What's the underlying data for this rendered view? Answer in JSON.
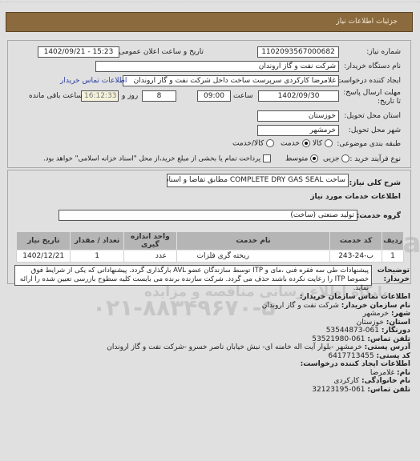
{
  "header": {
    "title": "جزئیات اطلاعات نیاز"
  },
  "form": {
    "need_number": {
      "label": "شماره نیاز:",
      "value": "1102093567000682"
    },
    "announce_datetime": {
      "label": "تاریخ و ساعت اعلان عمومی:",
      "value": "1402/09/21 - 15:23"
    },
    "buyer_org": {
      "label": "نام دستگاه خریدار:",
      "value": "شرکت نفت و گاز اروندان"
    },
    "requester": {
      "label": "ایجاد کننده درخواست:",
      "value": "غلامرضا کارکردی سرپرست ساخت داخل شرکت نفت و گاز اروندان"
    },
    "buyer_contact_link": "اطلاعات تماس خریدار",
    "deadline": {
      "label": "مهلت ارسال پاسخ: تا تاریخ:",
      "date": "1402/09/30",
      "time_label": "ساعت",
      "time": "09:00",
      "days": "8",
      "days_label": "روز و",
      "remaining": "16:12:33",
      "remaining_label": "ساعت باقی مانده"
    },
    "province": {
      "label": "استان محل تحویل:",
      "value": "خوزستان"
    },
    "city": {
      "label": "شهر محل تحویل:",
      "value": "خرمشهر"
    },
    "category": {
      "label": "طبقه بندی موضوعی:",
      "options": [
        {
          "label": "کالا",
          "selected": false
        },
        {
          "label": "خدمت",
          "selected": true
        },
        {
          "label": "کالا/خدمت",
          "selected": false
        }
      ]
    },
    "purchase_process": {
      "label": "نوع فرآیند خرید :",
      "options": [
        {
          "label": "جزیی",
          "selected": false
        },
        {
          "label": "متوسط",
          "selected": true
        }
      ],
      "checkbox_label": "پرداخت تمام یا بخشی از مبلغ خرید،از محل \"اسناد خزانه اسلامی\" خواهد بود.",
      "checkbox_checked": false
    }
  },
  "summary": {
    "label": "شرح کلی نیاز:",
    "value": "ساخت COMPLETE DRY GAS SEAL مطابق تقاضا و اسناد پیوست.",
    "services_heading": "اطلاعات خدمات مورد نیاز",
    "service_group_label": "گروه خدمت:",
    "service_group_value": "تولید صنعتی (ساخت)"
  },
  "table": {
    "headers": [
      "ردیف",
      "کد خدمت",
      "نام خدمت",
      "واحد اندازه گیری",
      "تعداد / مقدار",
      "تاریخ نیاز"
    ],
    "rows": [
      [
        "1",
        "ب-24-243",
        "ریخته گری فلزات",
        "عدد",
        "1",
        "1402/12/21"
      ]
    ]
  },
  "buyer_notes": {
    "label": "توضیحات خریدار:",
    "value": "پیشنهادات طی سه فقره فنی ،مای و ITP توسط سازندگان عضو AVL بارگذاری گردد. پیشنهاداتی که یکی از شرایط فوق خصوصا ITP را رعایت نکرده باشند حذف می گردد. شرکت سازنده برنده می بایست کلیه سطوح بازرسی تعیین شده را ارائه نماید."
  },
  "contact": {
    "heading": "اطلاعات تماس سازمان خریدار:",
    "org_label": "نام سازمان خریدار:",
    "org": "شرکت نفت و گاز اروندان",
    "city_label": "شهر:",
    "city": "خرمشهر",
    "province_label": "استان:",
    "province": "خوزستان",
    "fax_label": "دورنگار:",
    "fax": "061-53544873",
    "phone_label": "تلفن تماس:",
    "phone": "061-53521980",
    "address_label": "آدرس پستی:",
    "address": "خرمشهر -بلوار آیت اله خامنه ای- نبش خیابان ناصر خسرو -شرکت نفت و گاز اروندان",
    "postal_label": "کد پستی:",
    "postal": "6417713455",
    "requester_heading": "اطلاعات ایجاد کننده درخواست:",
    "name_label": "نام:",
    "name": "غلامرضا",
    "family_label": "نام خانوادگی:",
    "family": "کارکردی",
    "req_phone_label": "تلفن تماس:",
    "req_phone": "061-32123195"
  },
  "watermark": {
    "brand": "ParsNamadData",
    "slogan": "پایگاه اطلاع رسانی مناقصه و مزایده",
    "phone": "۰۲۱-۸۸۳۴۹۶۷۰-۵"
  }
}
